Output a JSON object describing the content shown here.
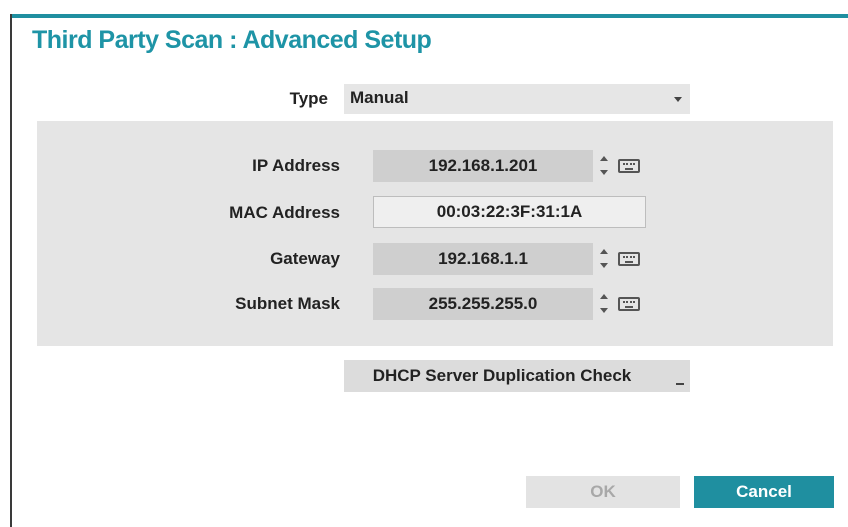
{
  "dialog": {
    "title": "Third Party Scan : Advanced Setup"
  },
  "type": {
    "label": "Type",
    "value": "Manual"
  },
  "network": {
    "ip_address": {
      "label": "IP Address",
      "value": "192.168.1.201"
    },
    "mac_address": {
      "label": "MAC Address",
      "value": "00:03:22:3F:31:1A"
    },
    "gateway": {
      "label": "Gateway",
      "value": "192.168.1.1"
    },
    "subnet_mask": {
      "label": "Subnet Mask",
      "value": "255.255.255.0"
    }
  },
  "buttons": {
    "dhcp_check": "DHCP Server Duplication Check",
    "ok": "OK",
    "cancel": "Cancel"
  },
  "colors": {
    "accent": "#1f8fa0",
    "title": "#1e94a6",
    "panel_bg": "#e5e5e5",
    "disabled_text": "#a8a8a8"
  },
  "icons": {
    "spinner": "spinner-up-down-icon",
    "keyboard": "keyboard-icon",
    "dropdown": "chevron-down-icon"
  }
}
